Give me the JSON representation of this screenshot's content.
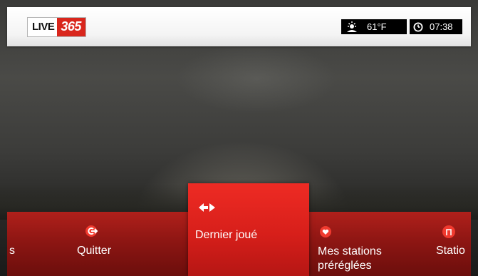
{
  "header": {
    "logo_live": "LIVE",
    "logo_number": "365",
    "temperature": "61°F",
    "time": "07:38"
  },
  "menu": {
    "items": [
      {
        "label": "s",
        "icon": "none"
      },
      {
        "label": "Quitter",
        "icon": "exit-icon"
      },
      {
        "label": "Dernier joué",
        "icon": "back-forward-icon",
        "selected": true
      },
      {
        "label_line1": "Mes stations",
        "label_line2": "préréglées",
        "icon": "heart-icon"
      },
      {
        "label": "Statio",
        "icon": "station-icon"
      }
    ]
  },
  "colors": {
    "brand_red": "#d9261c",
    "menu_red": "#8e1613",
    "selected_red": "#e8261f"
  }
}
